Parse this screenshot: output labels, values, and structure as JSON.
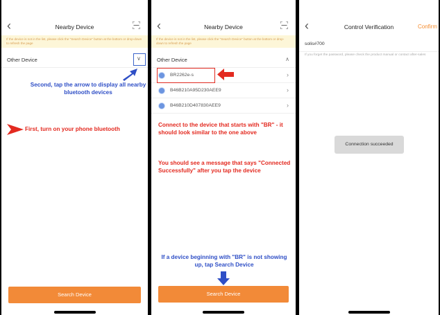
{
  "panel1": {
    "title": "Nearby Device",
    "back_icon": "chevron-left-icon",
    "scan_icon": "scan-icon",
    "notice": "If the device is not in the list, please click the \"Search Device\" button at the bottom or drop-down to refresh the page",
    "section_label": "Other Device",
    "instruction_second": "Second, tap the arrow to display all nearby bluetooth devices",
    "instruction_first": "First, turn on your phone bluetooth",
    "search_button": "Search Device"
  },
  "panel2": {
    "title": "Nearby Device",
    "notice": "If the device is not in the list, please click the \"Search Device\" button at the bottom or drop-down to refresh the page",
    "section_label": "Other Device",
    "devices": [
      {
        "name": "BR2262e-s"
      },
      {
        "name": "B46B210A95D230AEE9"
      },
      {
        "name": "B46B210D407830AEE9"
      }
    ],
    "instruction_connect": "Connect to the device that starts with \"BR\" - it should look similar to the one above",
    "instruction_message": "You should see a message that says \"Connected Successfully\" after you tap the device",
    "instruction_search": "If a device beginning with \"BR\" is not showing up, tap Search Device",
    "search_button": "Search Device"
  },
  "panel3": {
    "title": "Control Verification",
    "confirm": "Confirm",
    "password_value": "solis#700",
    "hint": "If you forget the password, please check the product manual or contact after-sales",
    "toast": "Connection succeeded"
  },
  "colors": {
    "accent_orange": "#f28a38",
    "annotation_blue": "#2f4fc6",
    "annotation_red": "#e32a20",
    "notice_bg": "#fdf6d8"
  }
}
